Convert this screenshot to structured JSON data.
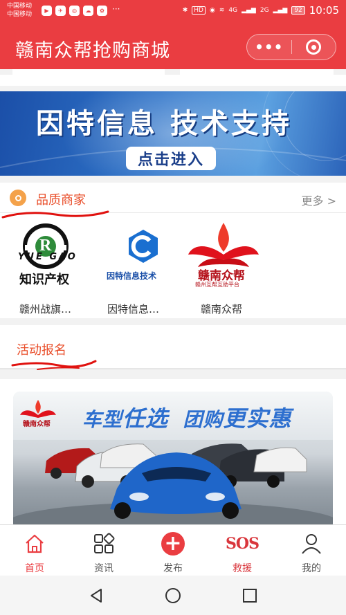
{
  "status_bar": {
    "carrier_1": "中国移动",
    "carrier_2": "中国移动",
    "battery": "92",
    "time": "10:05",
    "network": "4G",
    "network2": "2G",
    "hd": "HD"
  },
  "nav": {
    "title": "赣南众帮抢购商城",
    "more_icon": "ellipsis-icon",
    "close_icon": "target-icon"
  },
  "banner": {
    "headline": "因特信息  技术支持",
    "button": "点击进入"
  },
  "merchants": {
    "title": "品质商家",
    "more": "更多 >",
    "items": [
      {
        "name": "赣州战旗…",
        "logo_text_top": "YUE GAO",
        "logo_caption": "知识产权",
        "logo_letter": "R"
      },
      {
        "name": "因特信息…",
        "logo_caption": "因特信息技术"
      },
      {
        "name": "赣南众帮",
        "logo_caption": "赣南众帮",
        "logo_sub": "赣州互帮互助平台"
      }
    ]
  },
  "activities": {
    "title": "活动报名"
  },
  "promo": {
    "headline_part1": "车型",
    "headline_part2": "任选",
    "headline_part3": "团购",
    "headline_part4": "更实惠",
    "logo_caption": "赣南众帮"
  },
  "tabbar": {
    "tabs": [
      {
        "label": "首页",
        "icon": "home-icon",
        "active": true
      },
      {
        "label": "资讯",
        "icon": "grid-icon",
        "active": false
      },
      {
        "label": "发布",
        "icon": "plus-icon",
        "active": false
      },
      {
        "label": "救援",
        "icon": "sos-icon",
        "active": false,
        "icon_text": "SOS"
      },
      {
        "label": "我的",
        "icon": "user-icon",
        "active": false
      }
    ]
  },
  "colors": {
    "brand": "#ea3d41",
    "section_title": "#e94e2a",
    "banner_blue": "#2f74c9"
  }
}
